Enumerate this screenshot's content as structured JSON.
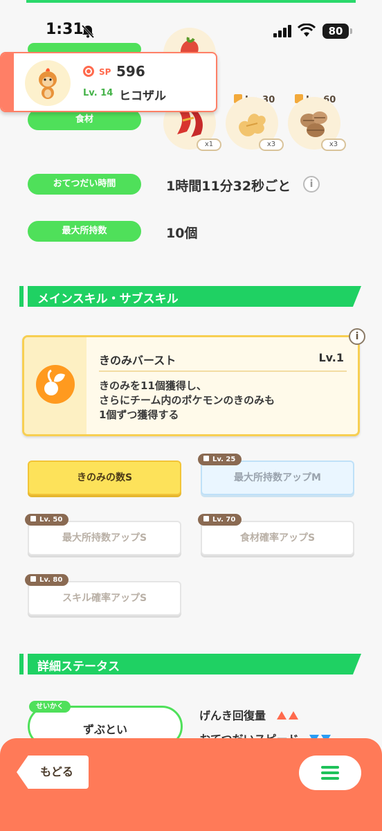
{
  "status": {
    "time": "1:31",
    "battery": "80"
  },
  "pokemon": {
    "sp_label": "SP",
    "sp_value": "596",
    "level": "Lv. 14",
    "name": "ヒコザル"
  },
  "labels": {
    "ingredients": "食材",
    "help_time": "おてつだい時間",
    "max_carry": "最大所持数"
  },
  "ingredients": [
    {
      "name": "berry-ingredient",
      "qty": "x1",
      "unlock": ""
    },
    {
      "name": "ginger-ingredient",
      "qty": "x3",
      "unlock": "Lv. 30"
    },
    {
      "name": "nut-ingredient",
      "qty": "x3",
      "unlock": "Lv. 60"
    }
  ],
  "values": {
    "help_time": "1時間11分32秒ごと",
    "max_carry": "10個"
  },
  "sections": {
    "skills": "メインスキル・サブスキル",
    "details": "詳細ステータス"
  },
  "main_skill": {
    "name": "きのみバースト",
    "level": "Lv.1",
    "desc": [
      "きのみを11個獲得し、",
      "さらにチーム内のポケモンのきのみも",
      "1個ずつ獲得する"
    ]
  },
  "sub_skills": [
    {
      "label": "きのみの数S",
      "lock": "",
      "state": "active"
    },
    {
      "label": "最大所持数アップM",
      "lock": "Lv. 25",
      "state": "blue"
    },
    {
      "label": "最大所持数アップS",
      "lock": "Lv. 50",
      "state": "locked"
    },
    {
      "label": "食材確率アップS",
      "lock": "Lv. 70",
      "state": "locked"
    },
    {
      "label": "スキル確率アップS",
      "lock": "Lv. 80",
      "state": "locked"
    }
  ],
  "nature": {
    "tag": "せいかく",
    "name": "ずぶとい"
  },
  "stats": [
    {
      "label": "げんき回復量",
      "dir": "up"
    },
    {
      "label": "おてつだいスピード",
      "dir": "down"
    }
  ],
  "nav": {
    "back": "もどる"
  },
  "colors": {
    "green": "#1fd163",
    "orange": "#ff7a58",
    "yellow": "#fde25a"
  }
}
